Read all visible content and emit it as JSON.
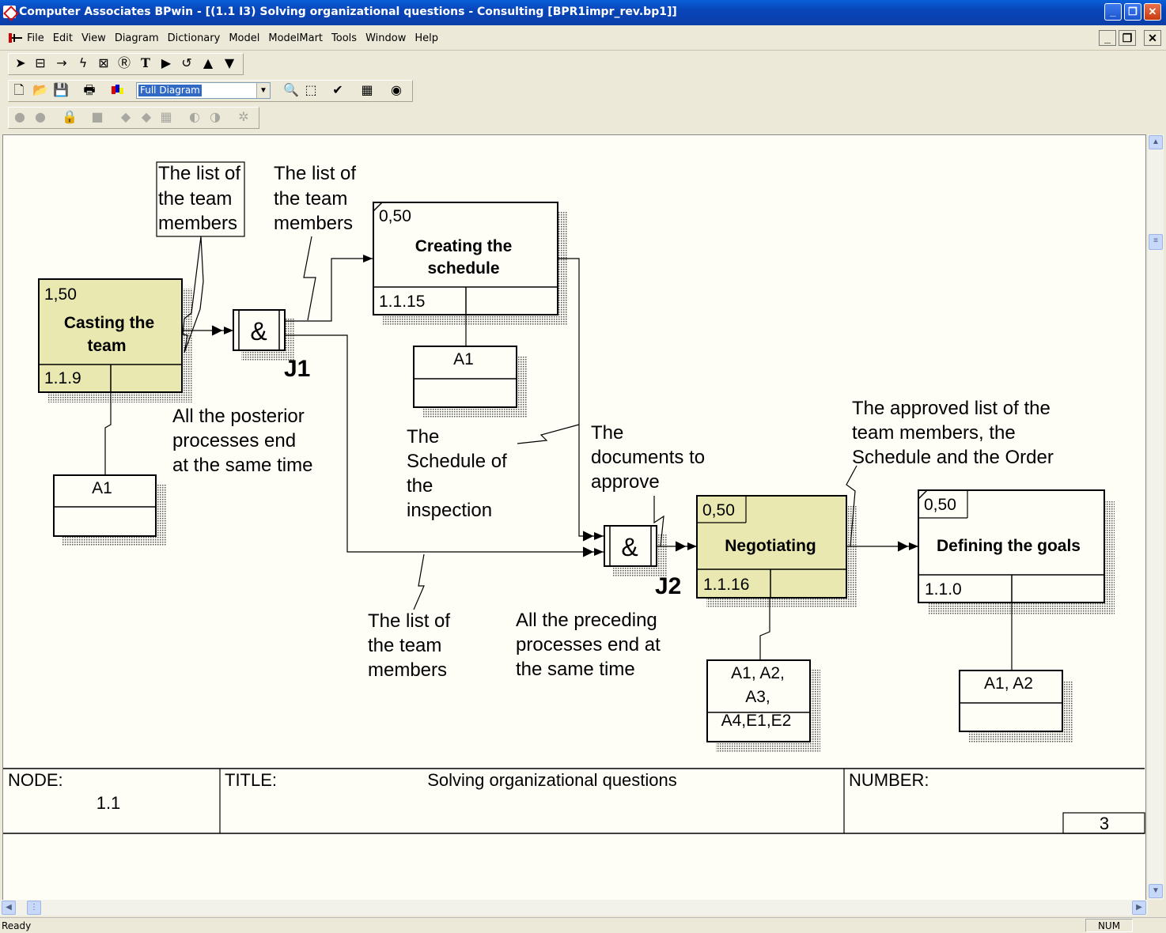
{
  "window": {
    "title": "Computer Associates BPwin - [(1.1 I3) Solving organizational questions - Consulting  [BPR1impr_rev.bp1]]"
  },
  "menu": [
    "File",
    "Edit",
    "View",
    "Diagram",
    "Dictionary",
    "Model",
    "ModelMart",
    "Tools",
    "Window",
    "Help"
  ],
  "toolbar": {
    "zoom_combo_value": "Full Diagram"
  },
  "diagram": {
    "boxes": {
      "casting": {
        "cost": "1,50",
        "name_lines": [
          "Casting the",
          "team"
        ],
        "number": "1.1.9",
        "resource_lines": [
          "A1"
        ]
      },
      "creating": {
        "cost": "0,50",
        "name_lines": [
          "Creating the",
          "schedule"
        ],
        "number": "1.1.15",
        "resource_lines": [
          "A1"
        ]
      },
      "negotiating": {
        "cost": "0,50",
        "name_lines": [
          "Negotiating"
        ],
        "number": "1.1.16",
        "resource_lines": [
          "A1, A2,",
          "A3,",
          "A4,E1,E2"
        ]
      },
      "defining": {
        "cost": "0,50",
        "name_lines": [
          "Defining the goals"
        ],
        "number": "1.1.0",
        "resource_lines": [
          "A1, A2"
        ]
      }
    },
    "junctions": {
      "j1": {
        "symbol": "&",
        "label": "J1"
      },
      "j2": {
        "symbol": "&",
        "label": "J2"
      }
    },
    "labels": {
      "list_boxed": [
        "The list of",
        "the team",
        "members"
      ],
      "list_top": [
        "The list of",
        "the team",
        "members"
      ],
      "posterior": [
        "All the posterior",
        "processes end",
        "at the same time"
      ],
      "schedule_insp": [
        "The",
        "Schedule of",
        "the",
        "inspection"
      ],
      "docs": [
        "The",
        "documents to",
        "approve"
      ],
      "approved": [
        "The approved list of the",
        "team members, the",
        "Schedule and the Order"
      ],
      "list_bottom": [
        "The list of",
        "the team",
        "members"
      ],
      "preceding": [
        "All the preceding",
        "processes end at",
        "the same time"
      ]
    }
  },
  "footer": {
    "node_label": "NODE:",
    "node_value": "1.1",
    "title_label": "TITLE:",
    "title_value": "Solving organizational questions",
    "number_label": "NUMBER:",
    "number_value": "3"
  },
  "status": {
    "left": "Ready",
    "num": "NUM"
  },
  "colors": {
    "uow_fill": "#e8e8b0",
    "canvas_bg": "#fffef6",
    "titlebar": "#0a4ec0"
  }
}
